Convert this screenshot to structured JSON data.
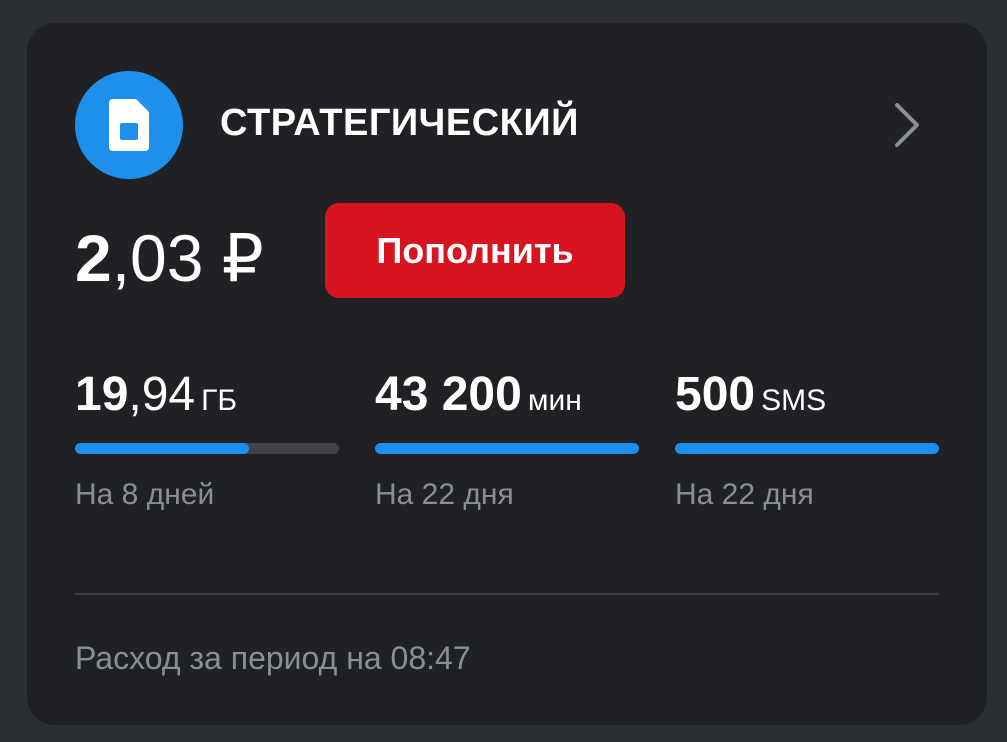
{
  "plan": {
    "title": "СТРАТЕГИЧЕСКИЙ",
    "icon": "sim-card-icon",
    "accent_color": "#1e90ec"
  },
  "balance": {
    "integer": "2",
    "fraction": ",03 ₽"
  },
  "topup": {
    "label": "Пополнить",
    "color": "#d7141f"
  },
  "stats": [
    {
      "value_major": "19",
      "value_minor": ",94",
      "unit": "ГБ",
      "period": "На 8 дней",
      "progress": 0.66
    },
    {
      "value_major": "43 200",
      "value_minor": "",
      "unit": "мин",
      "period": "На 22 дня",
      "progress": 1.0
    },
    {
      "value_major": "500",
      "value_minor": "",
      "unit": "SMS",
      "period": "На 22 дня",
      "progress": 1.0
    }
  ],
  "footer": {
    "text": "Расход за период на 08:47"
  }
}
